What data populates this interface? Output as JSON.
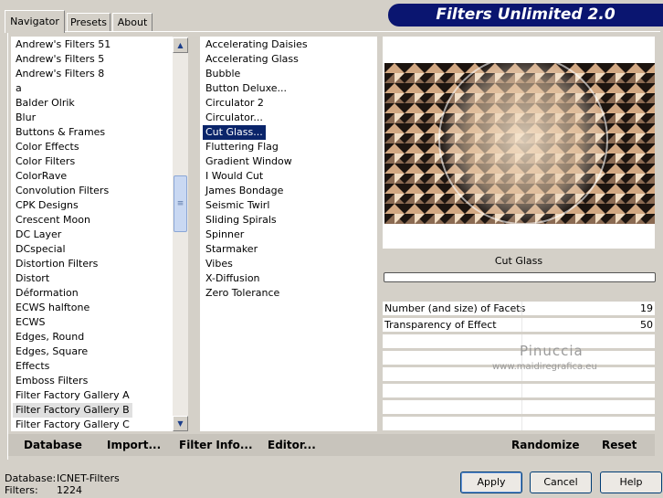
{
  "tabs": [
    {
      "label": "Navigator",
      "active": true
    },
    {
      "label": "Presets",
      "active": false
    },
    {
      "label": "About",
      "active": false
    }
  ],
  "banner": {
    "title": "Filters Unlimited 2.0"
  },
  "categories": [
    "Andrew's Filters 51",
    "Andrew's Filters 5",
    "Andrew's Filters 8",
    "a",
    "Balder Olrik",
    "Blur",
    "Buttons & Frames",
    "Color Effects",
    "Color Filters",
    "ColorRave",
    "Convolution Filters",
    "CPK Designs",
    "Crescent Moon",
    "DC Layer",
    "DCspecial",
    "Distortion Filters",
    "Distort",
    "Déformation",
    "ECWS halftone",
    "ECWS",
    "Edges, Round",
    "Edges, Square",
    "Effects",
    "Emboss Filters",
    "Filter Factory Gallery A",
    "Filter Factory Gallery B",
    "Filter Factory Gallery C"
  ],
  "selected_category": "Filter Factory Gallery B",
  "filters": [
    "Accelerating Daisies",
    "Accelerating Glass",
    "Bubble",
    "Button Deluxe...",
    "Circulator 2",
    "Circulator...",
    "Cut Glass...",
    "Fluttering Flag",
    "Gradient Window",
    "I Would Cut",
    "James Bondage",
    "Seismic Twirl",
    "Sliding Spirals",
    "Spinner",
    "Starmaker",
    "Vibes",
    "X-Diffusion",
    "Zero Tolerance"
  ],
  "selected_filter": "Cut Glass...",
  "preview": {
    "filter_name": "Cut Glass"
  },
  "params": [
    {
      "label": "Number (and size) of Facets",
      "value": "19"
    },
    {
      "label": "Transparency of Effect",
      "value": "50"
    }
  ],
  "watermark": {
    "name": "Pinuccia",
    "url": "www.maidiregrafica.eu"
  },
  "bottom_bar": {
    "database": "Database",
    "import": "Import...",
    "filter_info": "Filter Info...",
    "editor": "Editor...",
    "randomize": "Randomize",
    "reset": "Reset"
  },
  "status": {
    "database_label": "Database:",
    "database_value": "ICNET-Filters",
    "filters_label": "Filters:",
    "filters_value": "1224"
  },
  "buttons": {
    "apply": "Apply",
    "cancel": "Cancel",
    "help": "Help"
  },
  "colors": {
    "banner": "#0a1570",
    "selection": "#0a246a",
    "dialog": "#d4d0c8"
  }
}
